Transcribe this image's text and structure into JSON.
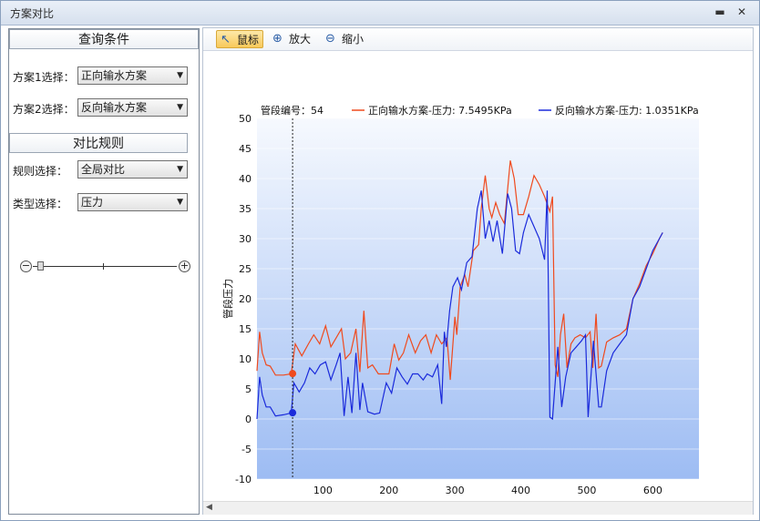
{
  "window": {
    "title": "方案对比",
    "minimize_glyph": "▬",
    "close_glyph": "✕"
  },
  "query": {
    "header": "查询条件",
    "scheme1_label": "方案1选择：",
    "scheme1_value": "正向输水方案",
    "scheme2_label": "方案2选择：",
    "scheme2_value": "反向输水方案"
  },
  "rules": {
    "header": "对比规则",
    "rule_label": "规则选择：",
    "rule_value": "全局对比",
    "type_label": "类型选择：",
    "type_value": "压力"
  },
  "toolbar": {
    "mouse_label": "鼠标",
    "zoom_in_label": "放大",
    "zoom_out_label": "缩小",
    "mouse_icon": "cursor-icon",
    "zoom_in_icon": "zoom-in-icon",
    "zoom_out_icon": "zoom-out-icon"
  },
  "zoom_slider": {
    "level": 0.05
  },
  "chart_data": {
    "type": "line",
    "ylabel": "管段压力",
    "xlabel": "",
    "ylim": [
      -10,
      50
    ],
    "xlim": [
      0,
      670
    ],
    "xticks": [
      100,
      200,
      300,
      400,
      500,
      600
    ],
    "yticks": [
      -10,
      -5,
      0,
      5,
      10,
      15,
      20,
      25,
      30,
      35,
      40,
      45,
      50
    ],
    "cursor": {
      "label": "管段编号：54",
      "x": 54
    },
    "series": [
      {
        "name": "正向输水方案-压力: 7.5495KPa",
        "color": "#ef4a1e",
        "marker_y": 7.5495,
        "points": [
          [
            0,
            8
          ],
          [
            4,
            14.5
          ],
          [
            8,
            11
          ],
          [
            14,
            9
          ],
          [
            20,
            8.8
          ],
          [
            28,
            7.3
          ],
          [
            40,
            7.3
          ],
          [
            52,
            7.5
          ],
          [
            58,
            12.5
          ],
          [
            68,
            10.5
          ],
          [
            78,
            12.5
          ],
          [
            86,
            14
          ],
          [
            95,
            12.5
          ],
          [
            104,
            15.5
          ],
          [
            112,
            12
          ],
          [
            120,
            13.5
          ],
          [
            128,
            15
          ],
          [
            134,
            10
          ],
          [
            142,
            11
          ],
          [
            150,
            15
          ],
          [
            156,
            7.8
          ],
          [
            162,
            18
          ],
          [
            168,
            8.5
          ],
          [
            175,
            9
          ],
          [
            184,
            7.5
          ],
          [
            200,
            7.5
          ],
          [
            208,
            12.5
          ],
          [
            215,
            9.8
          ],
          [
            222,
            11
          ],
          [
            230,
            14
          ],
          [
            240,
            11
          ],
          [
            248,
            13
          ],
          [
            256,
            14
          ],
          [
            264,
            11
          ],
          [
            272,
            14
          ],
          [
            280,
            12.5
          ],
          [
            288,
            13.5
          ],
          [
            293,
            6.5
          ],
          [
            300,
            17
          ],
          [
            303,
            14
          ],
          [
            308,
            22
          ],
          [
            315,
            24
          ],
          [
            320,
            22
          ],
          [
            328,
            28
          ],
          [
            336,
            29
          ],
          [
            340,
            35
          ],
          [
            346,
            40.5
          ],
          [
            352,
            35
          ],
          [
            356,
            33.5
          ],
          [
            362,
            36
          ],
          [
            368,
            34
          ],
          [
            375,
            32.5
          ],
          [
            384,
            43
          ],
          [
            390,
            40
          ],
          [
            396,
            34
          ],
          [
            404,
            34
          ],
          [
            412,
            37
          ],
          [
            420,
            40.5
          ],
          [
            428,
            39
          ],
          [
            436,
            37
          ],
          [
            444,
            34.5
          ],
          [
            448,
            37
          ],
          [
            452,
            9
          ],
          [
            456,
            7
          ],
          [
            460,
            14
          ],
          [
            465,
            17.5
          ],
          [
            470,
            8.5
          ],
          [
            476,
            12.5
          ],
          [
            482,
            13.5
          ],
          [
            490,
            14
          ],
          [
            498,
            13.5
          ],
          [
            505,
            14.5
          ],
          [
            509,
            8.5
          ],
          [
            514,
            17.5
          ],
          [
            518,
            8.5
          ],
          [
            522,
            8.8
          ],
          [
            530,
            12.8
          ],
          [
            540,
            13.5
          ],
          [
            550,
            14
          ],
          [
            560,
            15
          ],
          [
            570,
            20
          ],
          [
            580,
            22.5
          ],
          [
            590,
            25.5
          ],
          [
            600,
            27.5
          ],
          [
            610,
            30
          ],
          [
            615,
            31
          ]
        ]
      },
      {
        "name": "反向输水方案-压力: 1.0351KPa",
        "color": "#1a2adb",
        "marker_y": 1.0351,
        "points": [
          [
            0,
            0
          ],
          [
            4,
            7
          ],
          [
            8,
            4
          ],
          [
            14,
            2
          ],
          [
            20,
            2
          ],
          [
            28,
            0.5
          ],
          [
            40,
            0.7
          ],
          [
            52,
            1
          ],
          [
            56,
            6
          ],
          [
            64,
            4.5
          ],
          [
            72,
            6
          ],
          [
            80,
            8.5
          ],
          [
            88,
            7.5
          ],
          [
            96,
            9
          ],
          [
            104,
            9.5
          ],
          [
            112,
            6.5
          ],
          [
            120,
            9
          ],
          [
            126,
            11
          ],
          [
            132,
            0.5
          ],
          [
            138,
            7
          ],
          [
            144,
            1
          ],
          [
            150,
            11
          ],
          [
            156,
            1.5
          ],
          [
            160,
            6
          ],
          [
            168,
            1.2
          ],
          [
            178,
            0.8
          ],
          [
            186,
            1
          ],
          [
            196,
            6
          ],
          [
            204,
            4.3
          ],
          [
            212,
            8.5
          ],
          [
            220,
            7
          ],
          [
            228,
            5.8
          ],
          [
            236,
            7.5
          ],
          [
            244,
            7.5
          ],
          [
            252,
            6.5
          ],
          [
            258,
            7.5
          ],
          [
            266,
            7
          ],
          [
            274,
            9
          ],
          [
            280,
            2.5
          ],
          [
            284,
            14.5
          ],
          [
            287,
            12
          ],
          [
            292,
            18
          ],
          [
            297,
            22
          ],
          [
            304,
            23.5
          ],
          [
            310,
            21.5
          ],
          [
            318,
            26
          ],
          [
            326,
            27
          ],
          [
            334,
            35
          ],
          [
            340,
            38
          ],
          [
            346,
            30
          ],
          [
            352,
            33
          ],
          [
            358,
            29.5
          ],
          [
            364,
            33
          ],
          [
            372,
            27.5
          ],
          [
            380,
            37.5
          ],
          [
            386,
            35
          ],
          [
            392,
            28
          ],
          [
            398,
            27.5
          ],
          [
            404,
            31
          ],
          [
            412,
            34
          ],
          [
            420,
            32
          ],
          [
            428,
            30
          ],
          [
            436,
            26.5
          ],
          [
            440,
            38
          ],
          [
            444,
            0.3
          ],
          [
            448,
            0
          ],
          [
            452,
            6
          ],
          [
            456,
            12
          ],
          [
            462,
            2
          ],
          [
            468,
            7
          ],
          [
            476,
            11
          ],
          [
            484,
            12
          ],
          [
            492,
            13
          ],
          [
            498,
            14
          ],
          [
            502,
            0.3
          ],
          [
            510,
            13
          ],
          [
            518,
            2
          ],
          [
            522,
            2
          ],
          [
            530,
            8
          ],
          [
            540,
            11
          ],
          [
            550,
            12.5
          ],
          [
            560,
            14
          ],
          [
            570,
            20
          ],
          [
            580,
            22
          ],
          [
            590,
            25
          ],
          [
            600,
            28
          ],
          [
            610,
            30
          ],
          [
            615,
            31
          ]
        ]
      }
    ]
  }
}
